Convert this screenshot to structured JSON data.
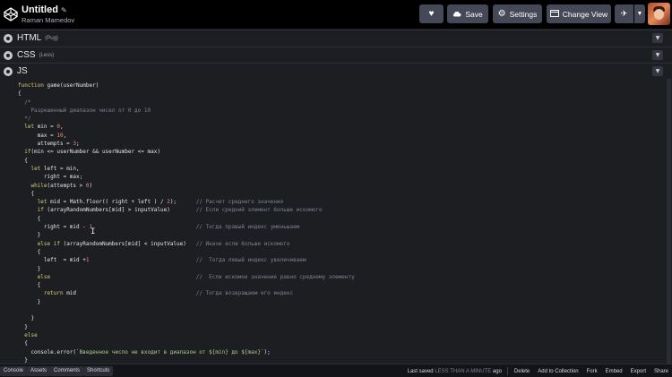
{
  "header": {
    "title": "Untitled",
    "author": "Raman Mamedov",
    "buttons": {
      "save": "Save",
      "settings": "Settings",
      "change_view": "Change View"
    },
    "icons": [
      "codepen-logo-icon",
      "pencil-icon",
      "heart-icon",
      "cloud-icon",
      "gear-icon",
      "view-icon",
      "pin-icon",
      "chevron-down-icon"
    ]
  },
  "panels": [
    {
      "lang": "HTML",
      "pre": "(Pug)"
    },
    {
      "lang": "CSS",
      "pre": "(Less)"
    },
    {
      "lang": "JS",
      "pre": ""
    }
  ],
  "code": {
    "lines": [
      "function game(userNumber)",
      "{",
      "  /*",
      "    Разрешенный диапазон чисел от 0 до 10",
      "  */",
      "  let min = 0,",
      "      max = 10,",
      "      attempts = 3;",
      "  if(min <= userNumber && userNumber <= max)",
      "  {",
      "    let left = min,",
      "        right = max;",
      "    while(attempts > 0)",
      "    {",
      "      let mid = Math.floor(( right + left ) / 2);      // Расчет среднего значения",
      "      if (arrayRandomNumbers[mid] > inputValue)        // Если средний элемент больше искомого",
      "      {",
      "        right = mid - 1                                // Тогда правый индекс уменьшаем",
      "      }",
      "      else if (arrayRandomNumbers[mid] < inputValue)   // Иначе если больше искомого",
      "      {",
      "        left  = mid +1                                 //  Тогда левый индекс увеличиваем",
      "      }",
      "      else                                             //  Если искомое значение равно среднему элементу",
      "      {",
      "        return mid                                     // Тогда возвращаем его индекс",
      "      }",
      "",
      "    }",
      "  }",
      "  else",
      "  {",
      "    console.error(`Введенное число не входит в диапазон от ${min} до ${max}`);",
      "  }"
    ]
  },
  "footer": {
    "tabs": [
      "Console",
      "Assets",
      "Comments",
      "Shortcuts"
    ],
    "saved_label": "Last saved",
    "saved_when": "LESS THAN A MINUTE",
    "saved_suffix": "ago",
    "actions": [
      "Delete",
      "Add to Collection",
      "Fork",
      "Embed",
      "Export",
      "Share"
    ]
  }
}
